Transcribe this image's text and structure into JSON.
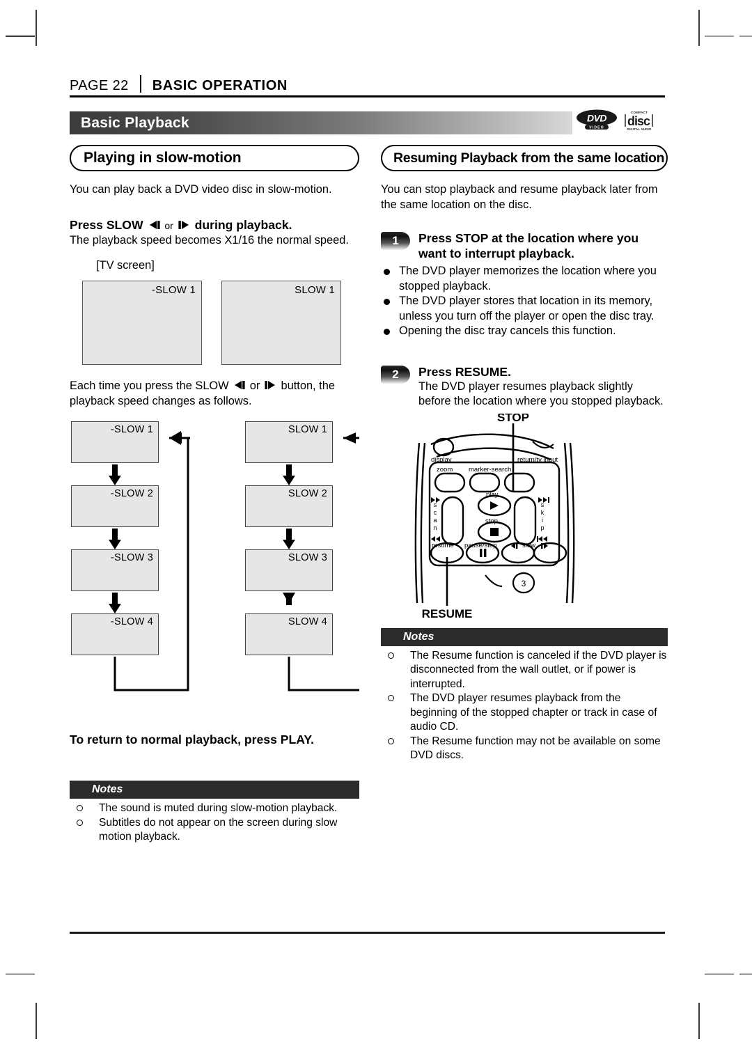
{
  "header": {
    "page_number": "PAGE 22",
    "section": "BASIC OPERATION"
  },
  "banner": {
    "title": "Basic Playback",
    "logos": [
      {
        "name": "dvd-video-logo",
        "text": "DVD",
        "sub": "VIDEO"
      },
      {
        "name": "compact-disc-digital-audio-logo",
        "top": "COMPACT",
        "text": "disc",
        "sub": "DIGITAL AUDIO"
      }
    ]
  },
  "left_column": {
    "heading": "Playing in slow-motion",
    "intro": "You can play back a DVD video disc in slow-motion.",
    "instruction": {
      "prefix": "Press SLOW",
      "or": "or",
      "suffix": "during playback.",
      "icon_left": "slow-reverse-icon",
      "icon_right": "slow-forward-icon"
    },
    "instruction_sub": "The playback speed becomes X1/16 the normal speed.",
    "tv_label": "[TV screen]",
    "tv_screens": [
      {
        "name": "tv-screen-slow-reverse",
        "osd": "-SLOW 1"
      },
      {
        "name": "tv-screen-slow-forward",
        "osd": "SLOW 1"
      }
    ],
    "each_time": {
      "prefix": "Each time you press the SLOW",
      "or": "or",
      "suffix": "button, the",
      "line2": "playback speed changes as follows."
    },
    "flow_reverse": [
      "-SLOW 1",
      "-SLOW 2",
      "-SLOW 3",
      "-SLOW 4"
    ],
    "flow_forward": [
      "SLOW 1",
      "SLOW 2",
      "SLOW 3",
      "SLOW 4"
    ],
    "return_note": "To return to normal playback, press PLAY.",
    "notes_title": "Notes",
    "notes": [
      "The sound is muted during slow-motion playback.",
      "Subtitles do not appear on the screen during slow motion playback."
    ]
  },
  "right_column": {
    "heading": "Resuming Playback from the same location",
    "intro": "You can stop playback and resume playback later from the same location on the disc.",
    "steps": [
      {
        "number": "1",
        "title_line1": "Press STOP at the location where you",
        "title_line2": "want to interrupt playback.",
        "bullets": [
          "The DVD player memorizes the location where you stopped playback.",
          "The DVD player stores that location in its memory, unless you turn off the player or open the disc tray.",
          "Opening the disc tray cancels this function."
        ]
      },
      {
        "number": "2",
        "title_line1": "Press RESUME.",
        "title_line2": "",
        "sub_line1": "The DVD player resumes playback slightly",
        "sub_line2": "before the location where you stopped playback."
      }
    ],
    "remote": {
      "callout_top": "STOP",
      "callout_bottom": "RESUME",
      "labels": {
        "display": "display",
        "return_tv_input": "return/tv input",
        "zoom": "zoom",
        "marker_search": "marker-search",
        "play": "play",
        "stop": "stop",
        "scan": "scan",
        "skip": "skip",
        "resume": "resume",
        "pause_step": "pause/step",
        "slow": "slow",
        "number_key": "3"
      }
    },
    "notes_title": "Notes",
    "notes": [
      "The Resume function is canceled if the DVD player is disconnected from the wall outlet, or if power is interrupted.",
      "The DVD player resumes playback from the beginning of the stopped chapter or track in case of audio CD.",
      "The Resume function may not be available on some DVD discs."
    ]
  },
  "colors": {
    "banner_dark": "#3b3b3b",
    "banner_light": "#d8d8d8",
    "notes_bar": "#2b2b2b",
    "screen_fill": "#e6e6e6",
    "rule": "#000000"
  }
}
